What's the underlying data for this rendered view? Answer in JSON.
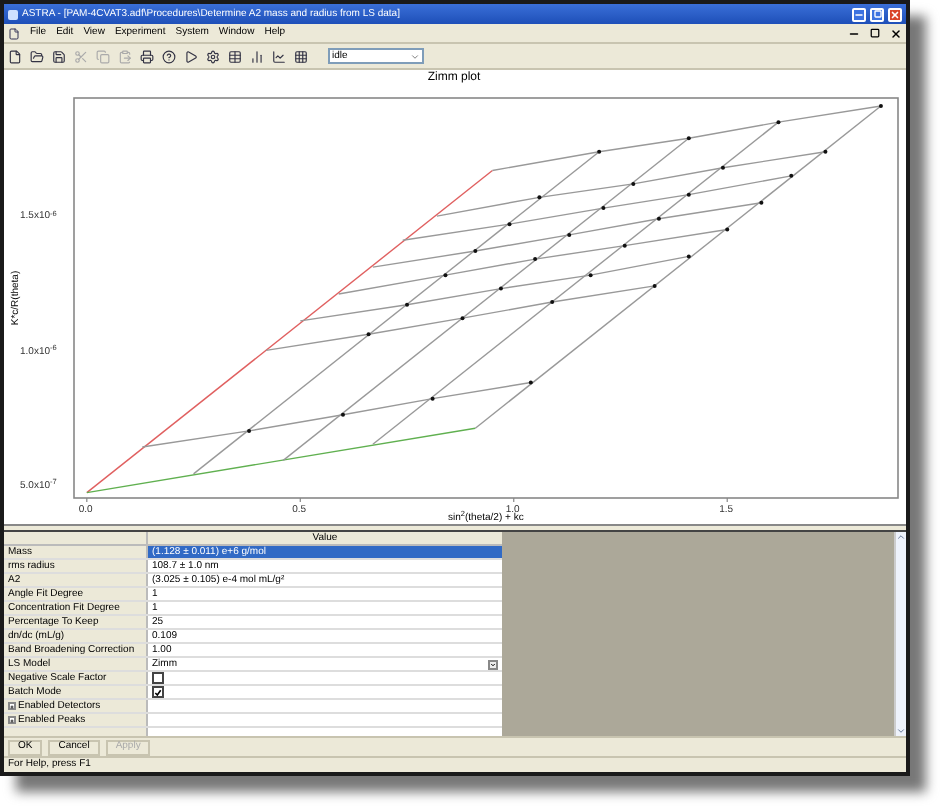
{
  "window": {
    "title": "ASTRA - [PAM-4CVAT3.adf\\Procedures\\Determine A2 mass and radius from LS data]"
  },
  "menu": [
    "File",
    "Edit",
    "View",
    "Experiment",
    "System",
    "Window",
    "Help"
  ],
  "toolbar": {
    "status_combo": {
      "value": "idle"
    }
  },
  "chart": {
    "chart_data": {
      "type": "line",
      "title": "Zimm plot",
      "xlabel": "sin$^{2}$(theta/2) + kc",
      "ylabel": "K*c/R(theta)",
      "xlim": [
        -0.03,
        1.9
      ],
      "ylim": [
        4.6e-07,
        1.95e-06
      ],
      "xticks": [
        {
          "value": 0,
          "label": "0.0"
        },
        {
          "value": 0.5,
          "label": "0.5"
        },
        {
          "value": 1,
          "label": "1.0"
        },
        {
          "value": 1.5,
          "label": "1.5"
        }
      ],
      "yticks": [
        {
          "value": 5e-07,
          "label": "5.0x10$^{-7}$"
        },
        {
          "value": 1e-06,
          "label": "1.0x10$^{-6}$"
        },
        {
          "value": 1.5e-06,
          "label": "1.5x10$^{-6}$"
        }
      ],
      "series": [
        {
          "color": "#e06060",
          "x": [
            0,
            0.95
          ],
          "values": [
            4.8e-07,
            1.68e-06
          ]
        },
        {
          "color": "#60b050",
          "x": [
            0,
            0.91
          ],
          "values": [
            4.8e-07,
            7.2e-07
          ]
        },
        {
          "color": "#999999",
          "x": [
            0.13,
            0.38,
            0.6,
            0.81,
            1.04
          ],
          "values": [
            6.5e-07,
            7.1e-07,
            7.7e-07,
            8.3e-07,
            8.9e-07
          ]
        },
        {
          "color": "#999999",
          "x": [
            0.42,
            0.66,
            0.88,
            1.09,
            1.33
          ],
          "values": [
            1.01e-06,
            1.07e-06,
            1.13e-06,
            1.19e-06,
            1.25e-06
          ]
        },
        {
          "color": "#999999",
          "x": [
            0.5,
            0.75,
            0.97,
            1.18,
            1.41
          ],
          "values": [
            1.12e-06,
            1.18e-06,
            1.24e-06,
            1.29e-06,
            1.36e-06
          ]
        },
        {
          "color": "#999999",
          "x": [
            0.59,
            0.84,
            1.05,
            1.26,
            1.5
          ],
          "values": [
            1.22e-06,
            1.29e-06,
            1.35e-06,
            1.4e-06,
            1.46e-06
          ]
        },
        {
          "color": "#999999",
          "x": [
            0.67,
            0.91,
            1.13,
            1.34,
            1.58
          ],
          "values": [
            1.32e-06,
            1.38e-06,
            1.44e-06,
            1.5e-06,
            1.56e-06
          ]
        },
        {
          "color": "#999999",
          "x": [
            0.74,
            0.99,
            1.21,
            1.41,
            1.65
          ],
          "values": [
            1.42e-06,
            1.48e-06,
            1.54e-06,
            1.59e-06,
            1.66e-06
          ]
        },
        {
          "color": "#999999",
          "x": [
            0.82,
            1.06,
            1.28,
            1.49,
            1.73
          ],
          "values": [
            1.51e-06,
            1.58e-06,
            1.63e-06,
            1.69e-06,
            1.75e-06
          ]
        },
        {
          "color": "#999999",
          "x": [
            0.95,
            1.2,
            1.41,
            1.62,
            1.86
          ],
          "values": [
            1.68e-06,
            1.75e-06,
            1.8e-06,
            1.86e-06,
            1.92e-06
          ]
        },
        {
          "color": "#999999",
          "x": [
            0.25,
            1.2
          ],
          "values": [
            5.5e-07,
            1.75e-06
          ]
        },
        {
          "color": "#999999",
          "x": [
            0.46,
            1.41
          ],
          "values": [
            6e-07,
            1.8e-06
          ]
        },
        {
          "color": "#999999",
          "x": [
            0.67,
            1.62
          ],
          "values": [
            6.6e-07,
            1.86e-06
          ]
        },
        {
          "color": "#999999",
          "x": [
            0.91,
            1.86
          ],
          "values": [
            7.2e-07,
            1.92e-06
          ]
        }
      ]
    }
  },
  "properties": {
    "header": "Value",
    "rows": [
      {
        "name": "Mass",
        "value": "(1.128 ± 0.011) e+6 g/mol",
        "kind": "text",
        "selected": true
      },
      {
        "name": "rms radius",
        "value": "108.7 ± 1.0 nm",
        "kind": "text",
        "selected": false
      },
      {
        "name": "A2",
        "value": "(3.025 ± 0.105) e-4 mol mL/g²",
        "kind": "text",
        "selected": false
      },
      {
        "name": "Angle Fit Degree",
        "value": "1",
        "kind": "text",
        "selected": false
      },
      {
        "name": "Concentration Fit Degree",
        "value": "1",
        "kind": "text",
        "selected": false
      },
      {
        "name": "Percentage To Keep",
        "value": "25",
        "kind": "text",
        "selected": false
      },
      {
        "name": "dn/dc (mL/g)",
        "value": "0.109",
        "kind": "text",
        "selected": false
      },
      {
        "name": "Band Broadening Correction",
        "value": "1.00",
        "kind": "text",
        "selected": false
      },
      {
        "name": "LS Model",
        "value": "Zimm",
        "kind": "dropdown",
        "selected": false
      },
      {
        "name": "Negative Scale Factor",
        "kind": "checkbox",
        "checked": false,
        "selected": false
      },
      {
        "name": "Batch Mode",
        "kind": "checkbox",
        "checked": true,
        "selected": false
      },
      {
        "name": "Enabled Detectors",
        "kind": "group",
        "expanded": false,
        "selected": false
      },
      {
        "name": "Enabled Peaks",
        "kind": "group",
        "expanded": false,
        "selected": false
      }
    ]
  },
  "buttons": [
    {
      "label": "OK",
      "disabled": false
    },
    {
      "label": "Cancel",
      "disabled": false
    },
    {
      "label": "Apply",
      "disabled": true
    }
  ],
  "status_bar": "For Help, press F1"
}
